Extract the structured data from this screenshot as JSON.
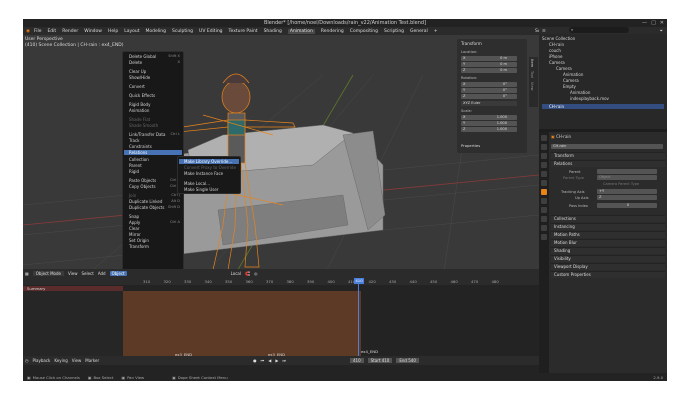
{
  "title": "Blender* [/home/noel/Downloads/rain_v22/Animation Test.blend]",
  "menus": [
    "File",
    "Edit",
    "Render",
    "Window",
    "Help"
  ],
  "workspaces": [
    "Layout",
    "Modeling",
    "Sculpting",
    "UV Editing",
    "Texture Paint",
    "Shading",
    "Animation",
    "Rendering",
    "Compositing",
    "Scripting",
    "General",
    "+"
  ],
  "active_workspace": "Animation",
  "scene": "Scene",
  "view_layer": "View Layer",
  "viewport": {
    "line1": "User Perspective",
    "line2": "(410) Scene Collection | CH-rain : ex4_END)"
  },
  "context_menu": [
    {
      "label": "Delete Global",
      "shortcut": "Shift X"
    },
    {
      "label": "Delete",
      "shortcut": "X"
    },
    {
      "label": "Clear Up",
      "shortcut": ""
    },
    {
      "label": "Show/Hide",
      "shortcut": ""
    },
    {
      "label": "Convert",
      "shortcut": ""
    },
    {
      "label": "Quick Effects",
      "shortcut": ""
    },
    {
      "label": "Rigid Body",
      "shortcut": ""
    },
    {
      "label": "Animation",
      "shortcut": ""
    },
    {
      "label": "Shade Flat",
      "shortcut": ""
    },
    {
      "label": "Shade Smooth",
      "shortcut": ""
    },
    {
      "label": "Link/Transfer Data",
      "shortcut": "Ctrl L"
    },
    {
      "label": "Track",
      "shortcut": ""
    },
    {
      "label": "Constraints",
      "shortcut": ""
    },
    {
      "label": "Relations",
      "shortcut": ""
    },
    {
      "label": "Collection",
      "shortcut": ""
    },
    {
      "label": "Parent",
      "shortcut": ""
    },
    {
      "label": "Rigid",
      "shortcut": ""
    },
    {
      "label": "Paste Objects",
      "shortcut": "Ctrl V"
    },
    {
      "label": "Copy Objects",
      "shortcut": "Ctrl C"
    },
    {
      "label": "Join",
      "shortcut": "Ctrl J"
    },
    {
      "label": "Duplicate Linked",
      "shortcut": "Alt D"
    },
    {
      "label": "Duplicate Objects",
      "shortcut": "Shift D"
    },
    {
      "label": "Snap",
      "shortcut": ""
    },
    {
      "label": "Apply",
      "shortcut": "Ctrl A"
    },
    {
      "label": "Clear",
      "shortcut": ""
    },
    {
      "label": "Mirror",
      "shortcut": ""
    },
    {
      "label": "Set Origin",
      "shortcut": ""
    },
    {
      "label": "Transform",
      "shortcut": ""
    }
  ],
  "submenu": [
    "Make Library Override...",
    "Convert Proxy to Override",
    "Make Instance Face",
    "Make Local...",
    "Make Single User"
  ],
  "npanel": {
    "title": "Transform",
    "location": "Location:",
    "rotation": "Rotation:",
    "scale": "Scale:",
    "xyz": [
      "X",
      "Y",
      "Z"
    ],
    "loc_vals": [
      "0 m",
      "0 m",
      "0 m"
    ],
    "rot_vals": [
      "0°",
      "0°",
      "0°"
    ],
    "rot_mode": "XYZ Euler",
    "scale_vals": [
      "1.000",
      "1.000",
      "1.000"
    ],
    "properties": "Properties",
    "tabs": [
      "Item",
      "Tool",
      "View"
    ]
  },
  "vp_header": {
    "mode": "Object Mode",
    "items": [
      "View",
      "Select",
      "Add",
      "Object"
    ],
    "pivot": "Local"
  },
  "timeline": {
    "ticks": [
      "310",
      "320",
      "330",
      "340",
      "350",
      "360",
      "370",
      "380",
      "390",
      "400",
      "410",
      "420",
      "430",
      "440",
      "450",
      "460",
      "470",
      "480"
    ],
    "current": "410",
    "summary": "Summary",
    "markers": [
      "ex3_END",
      "ex3_END",
      "ex4_END"
    ]
  },
  "playback": {
    "items": [
      "Playback",
      "Keying",
      "View",
      "Marker"
    ],
    "frame": "410",
    "start_label": "Start",
    "start": "410",
    "end_label": "End",
    "end": "540"
  },
  "status": [
    "Mouse Click on Channels",
    "Box Select",
    "Pan View",
    "Dope Sheet Context Menu"
  ],
  "version": "2.9.0",
  "outliner": {
    "title": "Scene Collection",
    "items": [
      "CH-rain",
      "couch",
      "iPhone",
      "Camera",
      "Camera",
      "Animation",
      "Camera",
      "Empty",
      "Animation",
      "indexplayback.mov",
      "CH-rain"
    ]
  },
  "props": {
    "object": "CH-rain",
    "name": "CH-rain",
    "sections": [
      "Transform",
      "Relations",
      "Collections",
      "Instancing",
      "Motion Paths",
      "Motion Blur",
      "Shading",
      "Visibility",
      "Viewport Display",
      "Custom Properties"
    ],
    "parent_label": "Parent",
    "parent_type_label": "Parent Type",
    "parent_type": "Object",
    "camera_parent": "Camera Parent Type",
    "tracking_axis_label": "Tracking Axis",
    "tracking_axis": "+Y",
    "up_axis_label": "Up Axis",
    "up_axis": "Z",
    "pass_index_label": "Pass Index",
    "pass_index": "0"
  }
}
